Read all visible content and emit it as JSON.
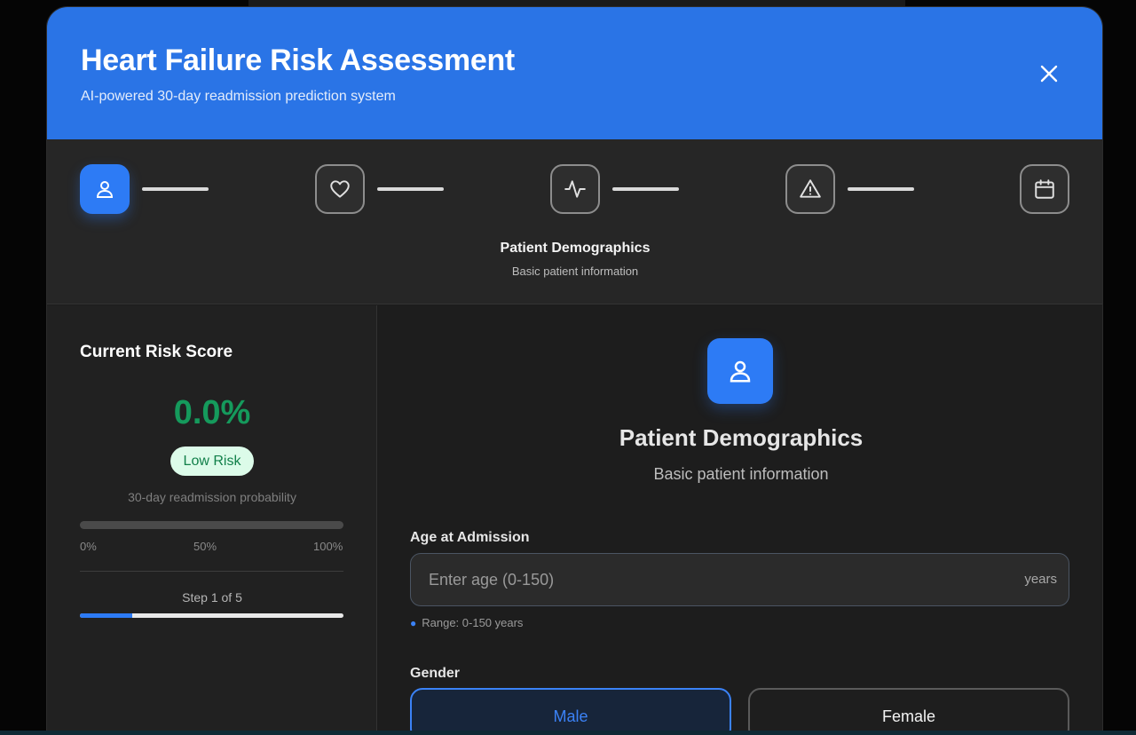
{
  "header": {
    "title": "Heart Failure Risk Assessment",
    "subtitle": "AI-powered 30-day readmission prediction system",
    "close_icon": "close-icon"
  },
  "stepper": {
    "steps": [
      {
        "icon": "user-icon",
        "active": true
      },
      {
        "icon": "heart-icon",
        "active": false
      },
      {
        "icon": "activity-icon",
        "active": false
      },
      {
        "icon": "warning-icon",
        "active": false
      },
      {
        "icon": "calendar-icon",
        "active": false
      }
    ],
    "current_title": "Patient Demographics",
    "current_description": "Basic patient information"
  },
  "sidebar": {
    "title": "Current Risk Score",
    "risk_percent": "0.0%",
    "risk_value": 0.0,
    "risk_label": "Low Risk",
    "caption": "30-day readmission probability",
    "scale": [
      "0%",
      "50%",
      "100%"
    ],
    "step_text": "Step 1 of 5",
    "progress_fraction": 0.2
  },
  "main": {
    "section_title": "Patient Demographics",
    "section_description": "Basic patient information",
    "age": {
      "label": "Age at Admission",
      "placeholder": "Enter age (0-150)",
      "value": "",
      "unit": "years",
      "hint": "Range: 0-150 years"
    },
    "gender": {
      "label": "Gender",
      "options": [
        "Male",
        "Female"
      ],
      "selected": "Male"
    }
  },
  "colors": {
    "accent": "#2d7bf5",
    "header": "#2a74e6",
    "risk_low": "#159a5c",
    "badge_bg": "#dcfbe9"
  }
}
